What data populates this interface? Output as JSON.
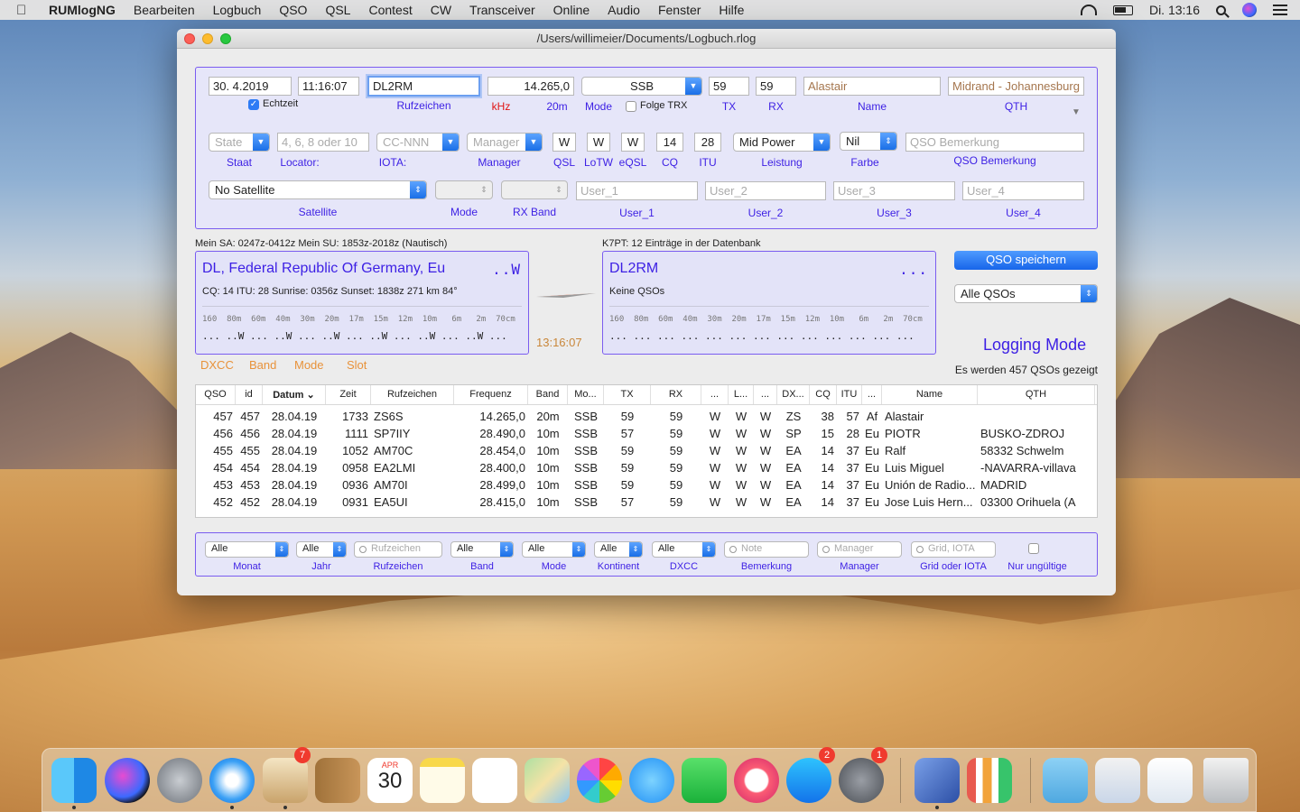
{
  "menubar": {
    "app_name": "RUMlogNG",
    "items": [
      "Bearbeiten",
      "Logbuch",
      "QSO",
      "QSL",
      "Contest",
      "CW",
      "Transceiver",
      "Online",
      "Audio",
      "Fenster",
      "Hilfe"
    ],
    "clock": "Di. 13:16"
  },
  "window": {
    "title": "/Users/willimeier/Documents/Logbuch.rlog"
  },
  "entry": {
    "date": "30.  4.2019",
    "time": "11:16:07",
    "echtzeit_label": "Echtzeit",
    "call": "DL2RM",
    "call_label": "Rufzeichen",
    "freq": "14.265,0",
    "freq_unit_label": "kHz",
    "band_label": "20m",
    "mode": "SSB",
    "mode_label": "Mode",
    "folge_trx_label": "Folge TRX",
    "tx": "59",
    "tx_label": "TX",
    "rx": "59",
    "rx_label": "RX",
    "name": "Alastair",
    "name_label": "Name",
    "qth": "Midrand - Johannesburg",
    "qth_label": "QTH",
    "state_placeholder": "State",
    "staat_label": "Staat",
    "locator_placeholder": "4, 6, 8 oder 10",
    "locator_label": "Locator:",
    "iota_placeholder": "CC-NNN",
    "iota_label": "IOTA:",
    "manager_placeholder": "Manager",
    "manager_label": "Manager",
    "qsl": "W",
    "qsl_label": "QSL",
    "lotw": "W",
    "lotw_label": "LoTW",
    "eqsl": "W",
    "eqsl_label": "eQSL",
    "cq": "14",
    "cq_label": "CQ",
    "itu": "28",
    "itu_label": "ITU",
    "power": "Mid Power",
    "power_label": "Leistung",
    "color": "Nil",
    "color_label": "Farbe",
    "remark_placeholder": "QSO Bemerkung",
    "remark_label": "QSO Bemerkung",
    "satellite": "No Satellite",
    "satellite_label": "Satellite",
    "sat_mode_label": "Mode",
    "rx_band_label": "RX Band",
    "user1_placeholder": "User_1",
    "user1_label": "User_1",
    "user2_placeholder": "User_2",
    "user2_label": "User_2",
    "user3_placeholder": "User_3",
    "user3_label": "User_3",
    "user4_placeholder": "User_4",
    "user4_label": "User_4"
  },
  "info": {
    "sun_text": "Mein SA: 0247z-0412z  Mein SU: 1853z-2018z (Nautisch)",
    "db_text": "K7PT: 12 Einträge in der Datenbank",
    "left_title": "DL, Federal Republic Of Germany, Eu",
    "left_tag": "..W",
    "left_sub": "CQ: 14  ITU: 28  Sunrise: 0356z  Sunset: 1838z  271 km  84°",
    "bands": "160  80m  60m  40m  30m  20m  17m  15m  12m  10m   6m   2m  70cm",
    "left_dots": "... ..W ... ..W ... ..W ... ..W ... ..W ... ..W ...",
    "right_title": "DL2RM",
    "right_tag": "...",
    "right_sub": "Keine QSOs",
    "right_dots": "... ... ... ... ... ... ... ... ... ... ... ... ...",
    "clock": "13:16:07",
    "tabs": [
      "DXCC",
      "Band",
      "Mode",
      "Slot"
    ]
  },
  "actions": {
    "save_label": "QSO speichern",
    "filter_select": "Alle QSOs",
    "mode_title": "Logging Mode",
    "count_text": "Es werden 457 QSOs gezeigt"
  },
  "table": {
    "headers": [
      "QSO",
      "id",
      "Datum",
      "Zeit",
      "Rufzeichen",
      "Frequenz",
      "Band",
      "Mo...",
      "TX",
      "RX",
      "...",
      "L...",
      "...",
      "DX...",
      "CQ",
      "ITU",
      "...",
      "Name",
      "QTH"
    ],
    "rows": [
      [
        "457",
        "457",
        "28.04.19",
        "1733",
        "ZS6S",
        "14.265,0",
        "20m",
        "SSB",
        "59",
        "59",
        "W",
        "W",
        "W",
        "ZS",
        "38",
        "57",
        "Af",
        "Alastair",
        ""
      ],
      [
        "456",
        "456",
        "28.04.19",
        "1111",
        "SP7IIY",
        "28.490,0",
        "10m",
        "SSB",
        "57",
        "59",
        "W",
        "W",
        "W",
        "SP",
        "15",
        "28",
        "Eu",
        "PIOTR",
        "BUSKO-ZDROJ"
      ],
      [
        "455",
        "455",
        "28.04.19",
        "1052",
        "AM70C",
        "28.454,0",
        "10m",
        "SSB",
        "59",
        "59",
        "W",
        "W",
        "W",
        "EA",
        "14",
        "37",
        "Eu",
        "Ralf",
        "58332 Schwelm"
      ],
      [
        "454",
        "454",
        "28.04.19",
        "0958",
        "EA2LMI",
        "28.400,0",
        "10m",
        "SSB",
        "59",
        "59",
        "W",
        "W",
        "W",
        "EA",
        "14",
        "37",
        "Eu",
        "Luis Miguel",
        "-NAVARRA-villava"
      ],
      [
        "453",
        "453",
        "28.04.19",
        "0936",
        "AM70I",
        "28.499,0",
        "10m",
        "SSB",
        "59",
        "59",
        "W",
        "W",
        "W",
        "EA",
        "14",
        "37",
        "Eu",
        "Unión de Radio...",
        "MADRID"
      ],
      [
        "452",
        "452",
        "28.04.19",
        "0931",
        "EA5UI",
        "28.415,0",
        "10m",
        "SSB",
        "57",
        "59",
        "W",
        "W",
        "W",
        "EA",
        "14",
        "37",
        "Eu",
        "Jose Luis Hern...",
        "03300 Orihuela (A"
      ]
    ]
  },
  "filters": {
    "monat": "Alle",
    "monat_label": "Monat",
    "jahr": "Alle",
    "jahr_label": "Jahr",
    "call_placeholder": "Rufzeichen",
    "call_label": "Rufzeichen",
    "band": "Alle",
    "band_label": "Band",
    "mode": "Alle",
    "mode_label": "Mode",
    "kontinent": "Alle",
    "kontinent_label": "Kontinent",
    "dxcc": "Alle",
    "dxcc_label": "DXCC",
    "note_placeholder": "Note",
    "note_label": "Bemerkung",
    "manager_placeholder": "Manager",
    "manager_label": "Manager",
    "grid_placeholder": "Grid, IOTA",
    "grid_label": "Grid oder IOTA",
    "invalid_label": "Nur ungültige"
  },
  "dock": {
    "calendar_month": "APR",
    "calendar_day": "30",
    "badges": {
      "mail": "7",
      "appstore": "2",
      "prefs": "1"
    },
    "icons": [
      "finder-icon",
      "siri-icon",
      "launchpad-icon",
      "safari-icon",
      "mail-icon",
      "contacts-icon",
      "calendar-icon",
      "notes-icon",
      "reminders-icon",
      "maps-icon",
      "photos-icon",
      "messages-icon",
      "facetime-icon",
      "music-icon",
      "appstore-icon",
      "system-preferences-icon",
      "logbook-icon",
      "numbers-icon",
      "downloads-folder-icon",
      "screenshot-icon",
      "preview-icon",
      "trash-icon"
    ]
  }
}
